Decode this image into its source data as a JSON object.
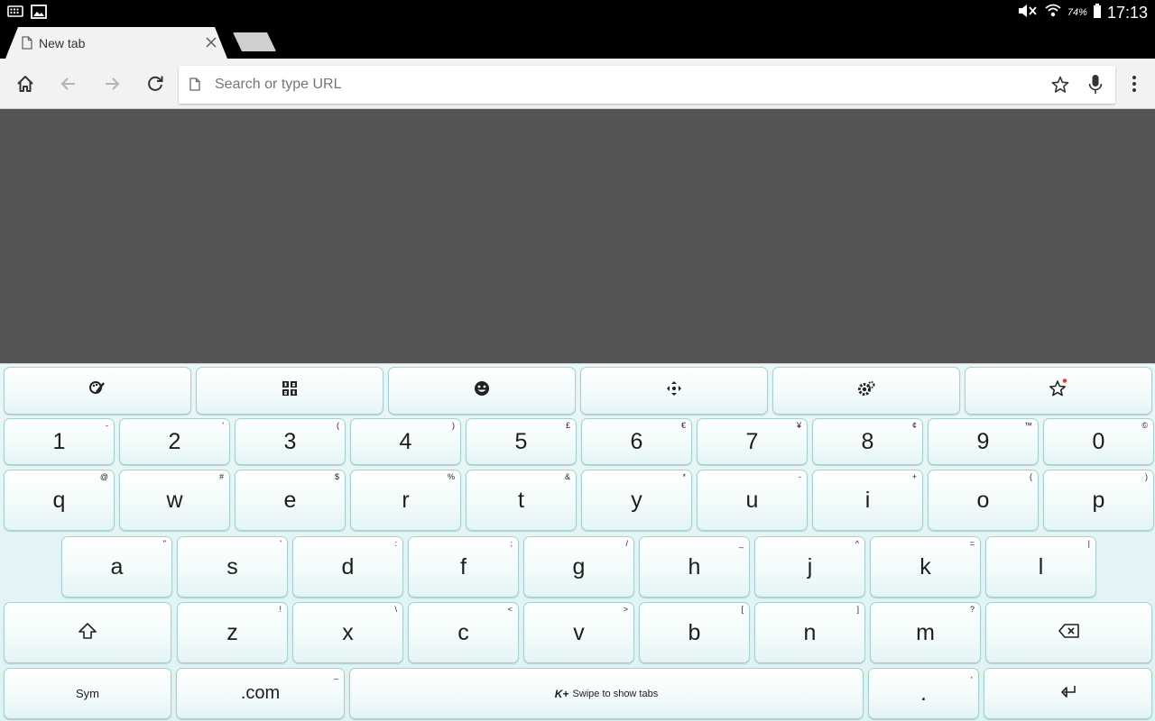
{
  "status_bar": {
    "battery_percent": "74%",
    "time": "17:13",
    "icons": [
      "keyboard-icon",
      "image-icon",
      "mute-icon",
      "wifi-icon",
      "battery-icon"
    ]
  },
  "tabs": [
    {
      "title": "New tab",
      "active": true
    }
  ],
  "toolbar": {
    "omnibox_placeholder": "Search or type URL",
    "omnibox_value": "",
    "icons": [
      "home-icon",
      "back-icon",
      "forward-icon",
      "reload-icon",
      "page-icon",
      "bookmark-star-icon",
      "microphone-icon",
      "overflow-menu-icon"
    ]
  },
  "keyboard": {
    "accent_color": "#e4f4f5",
    "function_row": [
      "theme-brush-icon",
      "number-pad-icon",
      "emoji-icon",
      "move-icon",
      "settings-icon",
      "star-icon"
    ],
    "number_row": [
      {
        "main": "1",
        "sub": "-"
      },
      {
        "main": "2",
        "sub": "'"
      },
      {
        "main": "3",
        "sub": "("
      },
      {
        "main": "4",
        "sub": ")"
      },
      {
        "main": "5",
        "sub": "£"
      },
      {
        "main": "6",
        "sub": "€"
      },
      {
        "main": "7",
        "sub": "¥"
      },
      {
        "main": "8",
        "sub": "¢"
      },
      {
        "main": "9",
        "sub": "™"
      },
      {
        "main": "0",
        "sub": "©"
      }
    ],
    "row_q": [
      {
        "main": "q",
        "sub": "@"
      },
      {
        "main": "w",
        "sub": "#"
      },
      {
        "main": "e",
        "sub": "$"
      },
      {
        "main": "r",
        "sub": "%"
      },
      {
        "main": "t",
        "sub": "&"
      },
      {
        "main": "y",
        "sub": "*"
      },
      {
        "main": "u",
        "sub": "-"
      },
      {
        "main": "i",
        "sub": "+"
      },
      {
        "main": "o",
        "sub": "("
      },
      {
        "main": "p",
        "sub": ")"
      }
    ],
    "row_a": [
      {
        "main": "a",
        "sub": "\""
      },
      {
        "main": "s",
        "sub": "'"
      },
      {
        "main": "d",
        "sub": ":"
      },
      {
        "main": "f",
        "sub": ";"
      },
      {
        "main": "g",
        "sub": "/"
      },
      {
        "main": "h",
        "sub": "_"
      },
      {
        "main": "j",
        "sub": "^"
      },
      {
        "main": "k",
        "sub": "="
      },
      {
        "main": "l",
        "sub": "|"
      }
    ],
    "row_z": [
      {
        "main": "z",
        "sub": "!"
      },
      {
        "main": "x",
        "sub": "\\"
      },
      {
        "main": "c",
        "sub": "<"
      },
      {
        "main": "v",
        "sub": ">"
      },
      {
        "main": "b",
        "sub": "["
      },
      {
        "main": "n",
        "sub": "]"
      },
      {
        "main": "m",
        "sub": "?"
      }
    ],
    "bottom_row": {
      "sym_label": "Sym",
      "com_label": ".com",
      "com_sub": "_",
      "space_label": "Swipe to show tabs",
      "space_logo": "K+",
      "period_label": ".",
      "period_sub": ","
    }
  }
}
